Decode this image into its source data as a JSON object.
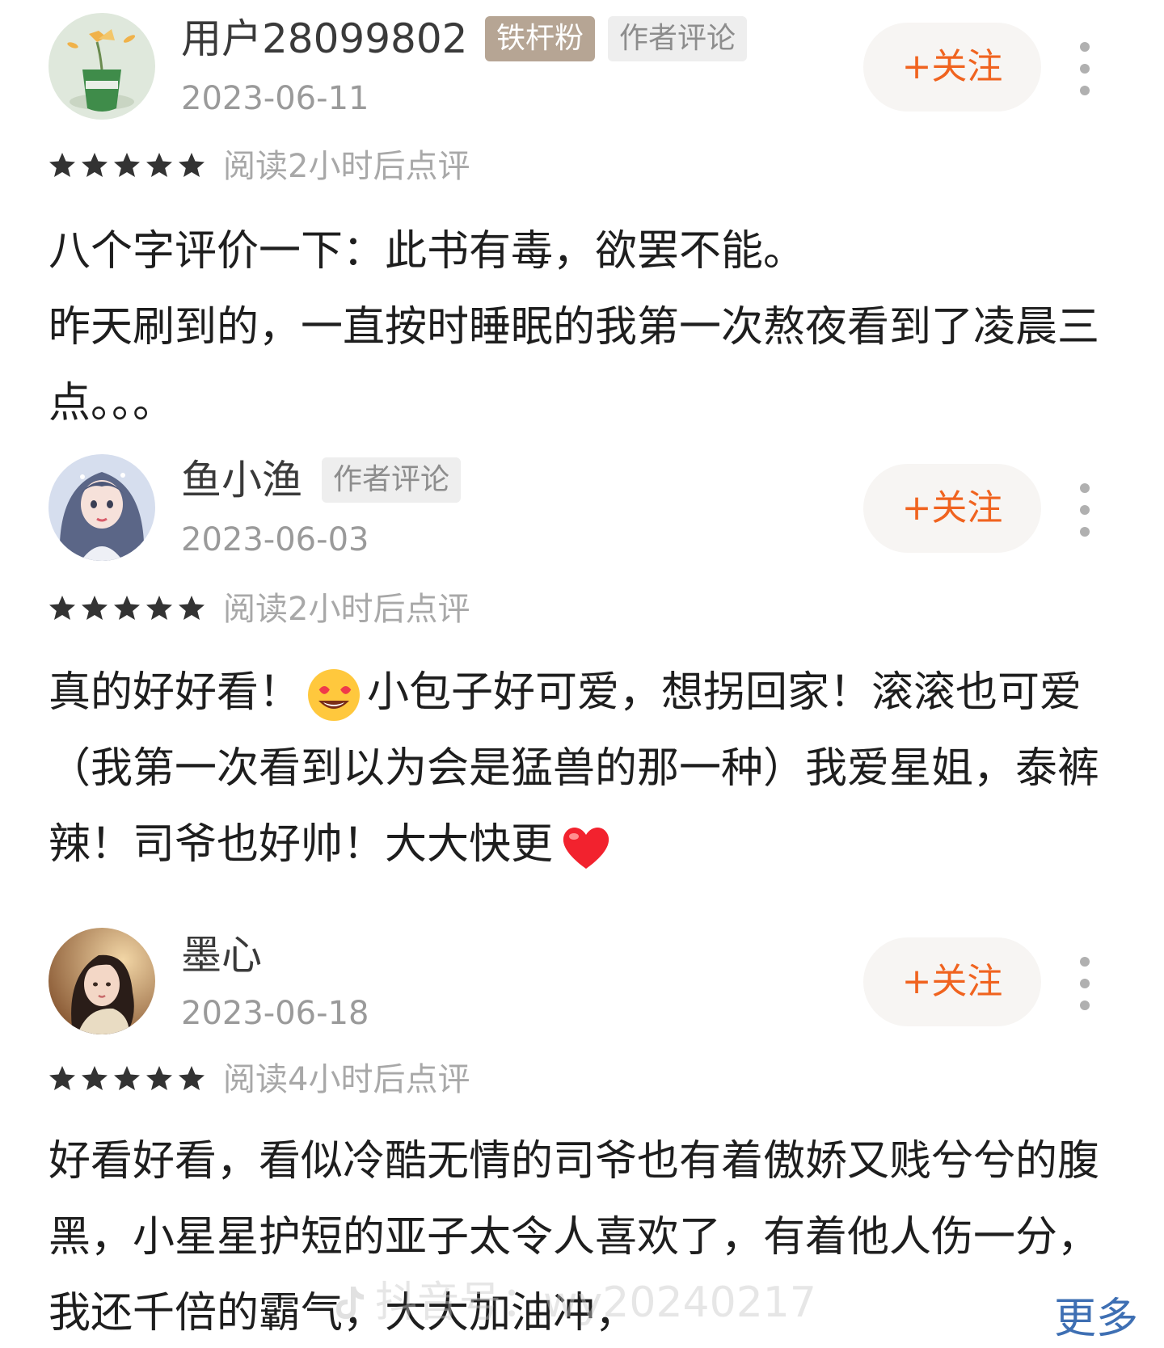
{
  "reviews": [
    {
      "username": "用户28099802",
      "badges": [
        "铁杆粉",
        "作者评论"
      ],
      "date": "2023-06-11",
      "follow_label": "+关注",
      "rating_stars": 5,
      "rating_note": "阅读2小时后点评",
      "content_lines": [
        "八个字评价一下：此书有毒，欲罢不能。",
        "昨天刷到的，一直按时睡眠的我第一次熬夜看到了凌晨三点。。。"
      ],
      "avatar_icon": "plant-icon"
    },
    {
      "username": "鱼小渔",
      "badges": [
        "作者评论"
      ],
      "date": "2023-06-03",
      "follow_label": "+关注",
      "rating_stars": 5,
      "rating_note": "阅读2小时后点评",
      "content_part1": "真的好好看！",
      "content_part2": "小包子好可爱，想拐回家！滚滚也可爱（我第一次看到以为会是猛兽的那一种）我爱星姐，泰裤辣！司爷也好帅！大大快更",
      "emojis": [
        "heart-eyes-emoji",
        "red-heart-emoji"
      ],
      "avatar_icon": "anime-girl-icon"
    },
    {
      "username": "墨心",
      "date": "2023-06-18",
      "follow_label": "+关注",
      "rating_stars": 5,
      "rating_note": "阅读4小时后点评",
      "content": "好看好看，看似冷酷无情的司爷也有着傲娇又贱兮兮的腹黑，小星星护短的亚子太令人喜欢了，有着他人伤一分，我还千倍的霸气，大大加油冲，",
      "avatar_icon": "photo-girl-icon"
    }
  ],
  "expand_label": "更多",
  "watermark": {
    "text": "抖音号：wy20240217",
    "icon": "douyin-icon"
  },
  "colors": {
    "accent": "#f0631f",
    "link": "#3e6fb3",
    "fan_badge": "#b6a594",
    "muted": "#9a9a9a"
  }
}
